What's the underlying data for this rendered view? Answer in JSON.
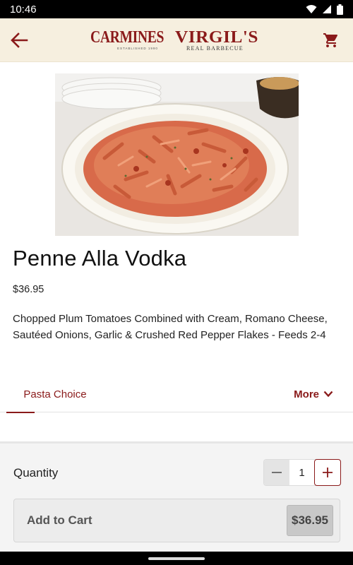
{
  "status_bar": {
    "time": "10:46"
  },
  "header": {
    "brand_left": "CARMINES",
    "brand_left_sub": "ESTABLISHED 1990",
    "brand_right": "VIRGIL'S",
    "brand_right_sub": "REAL BARBECUE"
  },
  "product": {
    "image_alt": "Penne Alla Vodka dish",
    "name": "Penne Alla Vodka",
    "price": "$36.95",
    "description": "Chopped Plum Tomatoes Combined with Cream, Romano Cheese, Sautéed Onions, Garlic & Crushed Red Pepper Flakes - Feeds 2-4"
  },
  "tabs": {
    "active": "Pasta Choice",
    "more": "More"
  },
  "purchase": {
    "quantity_label": "Quantity",
    "quantity": "1",
    "add_label": "Add to Cart",
    "total": "$36.95"
  },
  "colors": {
    "accent": "#8a1a1a",
    "header_bg": "#f6efdf"
  },
  "icons": [
    "back-arrow-icon",
    "cart-icon",
    "minus-icon",
    "plus-icon",
    "chevron-down-icon",
    "wifi-icon",
    "signal-icon",
    "battery-icon"
  ]
}
